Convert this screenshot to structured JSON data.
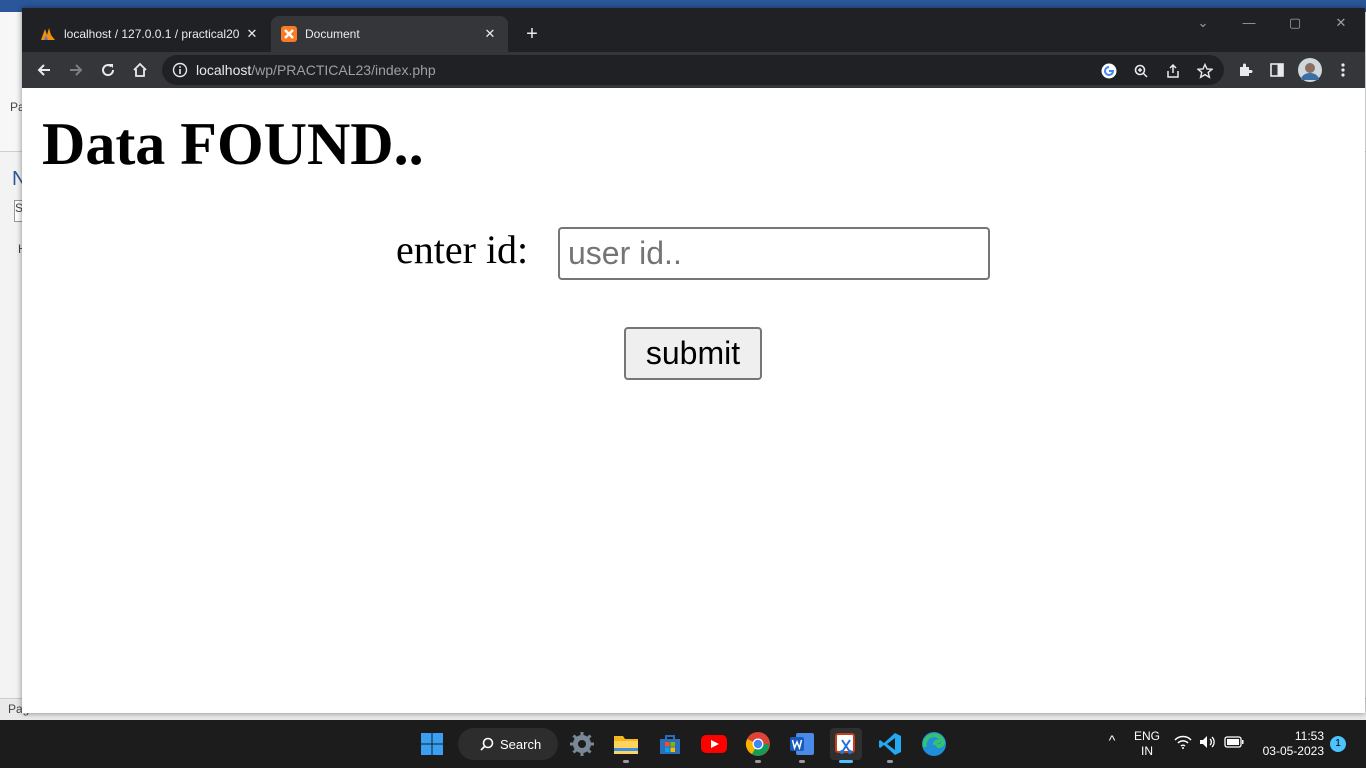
{
  "background_window": {
    "fragments": [
      "Pa",
      "N",
      "S",
      "H",
      "Pag"
    ]
  },
  "browser": {
    "tabs": [
      {
        "title": "localhost / 127.0.0.1 / practical20",
        "favicon": "phpmyadmin-icon",
        "active": false
      },
      {
        "title": "Document",
        "favicon": "xampp-icon",
        "active": true
      }
    ],
    "address": {
      "host": "localhost",
      "path": "/wp/PRACTICAL23/index.php"
    }
  },
  "page": {
    "heading": "Data FOUND..",
    "label": "enter id:",
    "input_placeholder": "user id..",
    "input_value": "",
    "submit_label": "submit"
  },
  "taskbar": {
    "search_label": "Search",
    "apps": [
      "settings-icon",
      "file-explorer-icon",
      "microsoft-store-icon",
      "youtube-icon",
      "chrome-icon",
      "word-icon",
      "snipping-tool-icon",
      "vscode-icon",
      "edge-icon"
    ],
    "language": "ENG",
    "region": "IN",
    "time": "11:53",
    "date": "03-05-2023",
    "notification_count": "1"
  },
  "colors": {
    "chrome_dark": "#202124",
    "chrome_toolbar": "#35363a",
    "taskbar": "#1c1c1c",
    "accent": "#4cc2ff"
  }
}
